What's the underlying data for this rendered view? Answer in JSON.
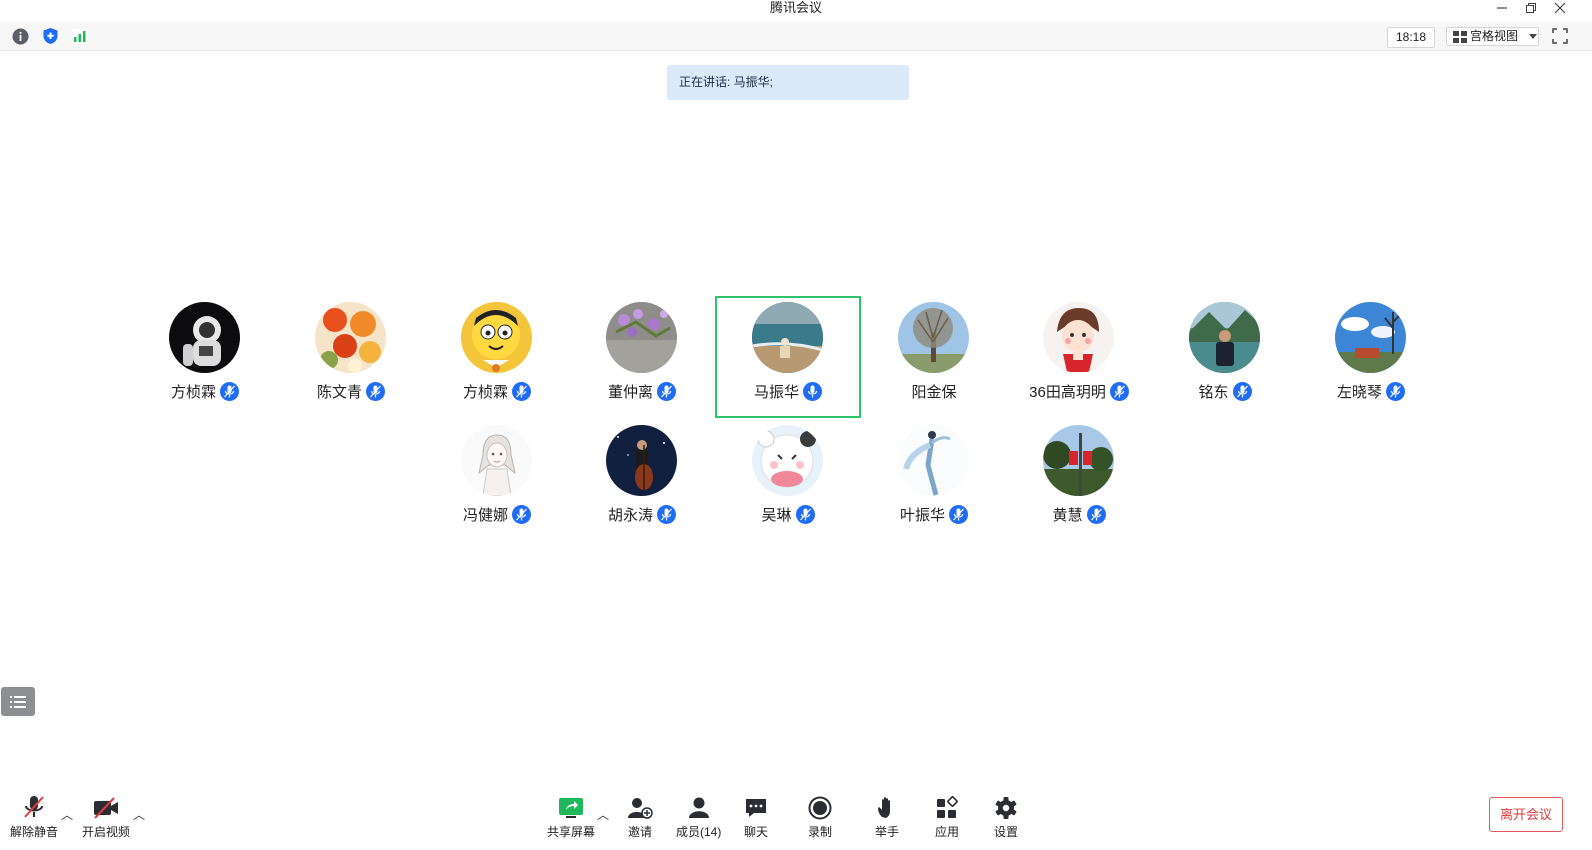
{
  "window": {
    "title": "腾讯会议"
  },
  "toolbar": {
    "clock": "18:18",
    "view_label": "宫格视图"
  },
  "speaking": {
    "text": "正在讲话: 马振华;"
  },
  "participants": [
    {
      "name": "方桢霖",
      "mic": "muted",
      "avatar": "astronaut"
    },
    {
      "name": "陈文青",
      "mic": "muted",
      "avatar": "flowers"
    },
    {
      "name": "方桢霖",
      "mic": "muted",
      "avatar": "cartoon-boy"
    },
    {
      "name": "董仲离",
      "mic": "muted",
      "avatar": "purple-flowers"
    },
    {
      "name": "马振华",
      "mic": "speaking",
      "avatar": "beach",
      "active": true
    },
    {
      "name": "阳金保",
      "mic": "none",
      "avatar": "tree"
    },
    {
      "name": "36田高玥明",
      "mic": "muted",
      "avatar": "cartoon-girl"
    },
    {
      "name": "铭东",
      "mic": "muted",
      "avatar": "man-landscape"
    },
    {
      "name": "左晓琴",
      "mic": "muted",
      "avatar": "blue-sky"
    },
    {
      "name": "冯健娜",
      "mic": "muted",
      "avatar": "sketch-girl"
    },
    {
      "name": "胡永涛",
      "mic": "muted",
      "avatar": "cello-night"
    },
    {
      "name": "吴琳",
      "mic": "muted",
      "avatar": "cute-bear"
    },
    {
      "name": "叶振华",
      "mic": "muted",
      "avatar": "dancer"
    },
    {
      "name": "黄慧",
      "mic": "muted",
      "avatar": "street-flags"
    }
  ],
  "bottom": {
    "unmute": "解除静音",
    "start_video": "开启视频",
    "share_screen": "共享屏幕",
    "invite": "邀请",
    "members": "成员(14)",
    "chat": "聊天",
    "record": "录制",
    "raise_hand": "举手",
    "apps": "应用",
    "settings": "设置",
    "leave": "离开会议"
  },
  "colors": {
    "accent": "#1f6cf5",
    "active_border": "#2ec26a",
    "leave": "#e23b3b",
    "signal": "#1fb85a"
  }
}
